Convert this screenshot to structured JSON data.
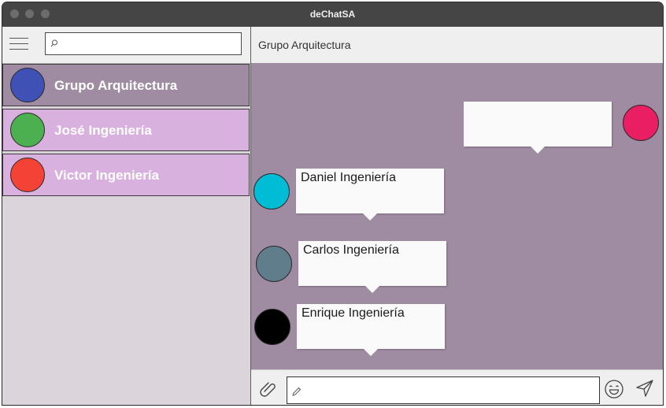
{
  "window": {
    "title": "deChatSA"
  },
  "sidebar": {
    "search": {
      "value": "",
      "placeholder": ""
    },
    "chats": [
      {
        "label": "Grupo Arquitectura",
        "avatar_color": "#3f51b5",
        "bg": "#a08ca2",
        "selected": true
      },
      {
        "label": "José Ingeniería",
        "avatar_color": "#4caf50",
        "bg": "#d9b1de",
        "selected": false
      },
      {
        "label": "Victor Ingeniería",
        "avatar_color": "#f44336",
        "bg": "#d9b1de",
        "selected": false
      }
    ]
  },
  "conversation": {
    "title": "Grupo Arquitectura",
    "messages": [
      {
        "sender": "",
        "avatar_color": "#e91e63",
        "own": true
      },
      {
        "sender": "Daniel Ingeniería",
        "avatar_color": "#00bcd4",
        "own": false
      },
      {
        "sender": "Carlos Ingeniería",
        "avatar_color": "#607d8b",
        "own": false
      },
      {
        "sender": "Enrique Ingeniería",
        "avatar_color": "#000000",
        "own": false
      }
    ]
  },
  "composer": {
    "value": "",
    "placeholder": "",
    "icons": [
      "paperclip-icon",
      "pencil-icon",
      "emoji-icon",
      "send-icon"
    ]
  },
  "colors": {
    "titlebar": "#454545",
    "message_area": "#a08ca2",
    "sidebar_bg": "#dcd4db",
    "chat_item_bg": "#d9b1de"
  }
}
